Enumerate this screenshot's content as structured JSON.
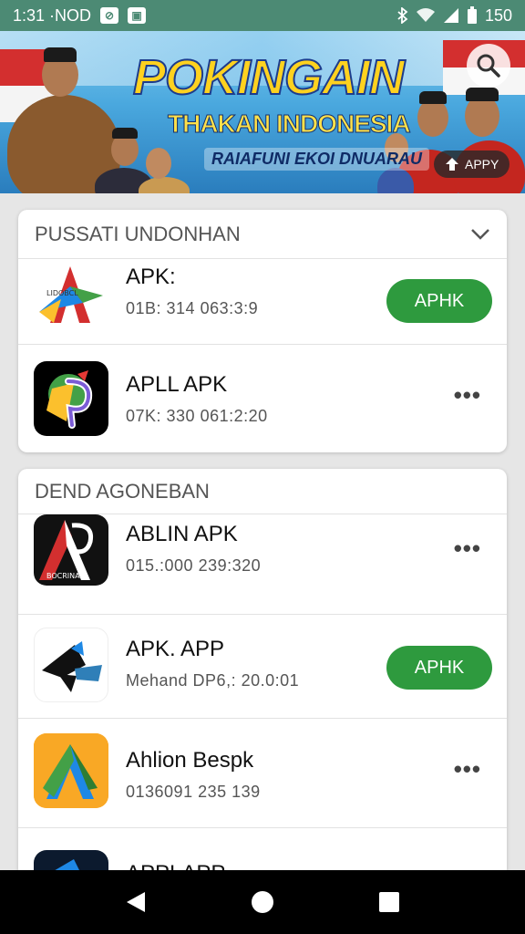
{
  "status_bar": {
    "time": "1:31 ·NOD",
    "battery": "150"
  },
  "banner": {
    "title": "POKINGAIN",
    "subtitle": "THAKAN INDONESIA",
    "tagline": "RAIAFUNI EKOI DNUARAU",
    "apply_label": "APPY"
  },
  "section1": {
    "header": "PUSSATI UNDONHAN",
    "items": [
      {
        "name": "APK:",
        "meta": "01B: 314 063:3:9",
        "action": "APHK"
      },
      {
        "name": "APLL APK",
        "meta": "07K: 330 061:2:20",
        "action": "more"
      }
    ]
  },
  "section2": {
    "header": "DEND AGONEBAN",
    "items": [
      {
        "name": "ABLIN APK",
        "meta": "015.:000 239:320",
        "action": "more"
      },
      {
        "name": "APK. APP",
        "meta": "Mehand DP6,: 20.0:01",
        "action": "APHK"
      },
      {
        "name": "Ahlion Bespk",
        "meta": "0136091 235 139",
        "action": "more"
      },
      {
        "name": "APPLAPP",
        "meta": "",
        "action": "none"
      }
    ]
  },
  "more_glyph": "•••",
  "colors": {
    "status_bar": "#4c8a74",
    "accent_green": "#2e9a3e",
    "nav_bar": "#000000",
    "background": "#e6e6e6"
  }
}
